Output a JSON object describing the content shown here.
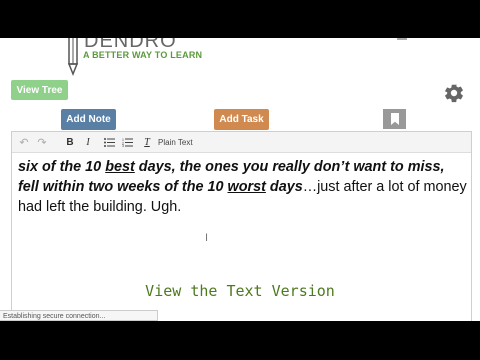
{
  "logo": {
    "word": "DENDRO",
    "tagline": "A BETTER WAY TO LEARN"
  },
  "buttons": {
    "view_tree": "View Tree",
    "add_note": "Add Note",
    "add_task": "Add Task"
  },
  "toolbar": {
    "undo": "↶",
    "redo": "↷",
    "bold": "B",
    "italic": "I",
    "bullet_list": "☰",
    "numbered_list": "☰",
    "clear_format": "T",
    "plain_text": "Plain Text"
  },
  "content": {
    "p1": "six of the 10 ",
    "p2": "best",
    "p3": " days, the ones you really don’t want to miss, fell within two weeks of the 10 ",
    "p4": "worst",
    "p5": " days",
    "p6": "…just after a lot of money had left the building. Ugh."
  },
  "view_text_link": "View the Text Version",
  "status_text": "Establishing secure connection...",
  "icons": [
    "pencil-logo-icon",
    "gear-icon",
    "bookmark-icon",
    "undo-icon",
    "redo-icon",
    "bullet-list-icon",
    "numbered-list-icon",
    "clear-format-icon"
  ],
  "colors": {
    "view_tree": "#8fd08a",
    "add_note": "#5a7fa5",
    "add_task": "#d08a4f",
    "bookmark": "#999999",
    "link_green": "#4d7a1f",
    "tagline_green": "#5a9a3c"
  }
}
